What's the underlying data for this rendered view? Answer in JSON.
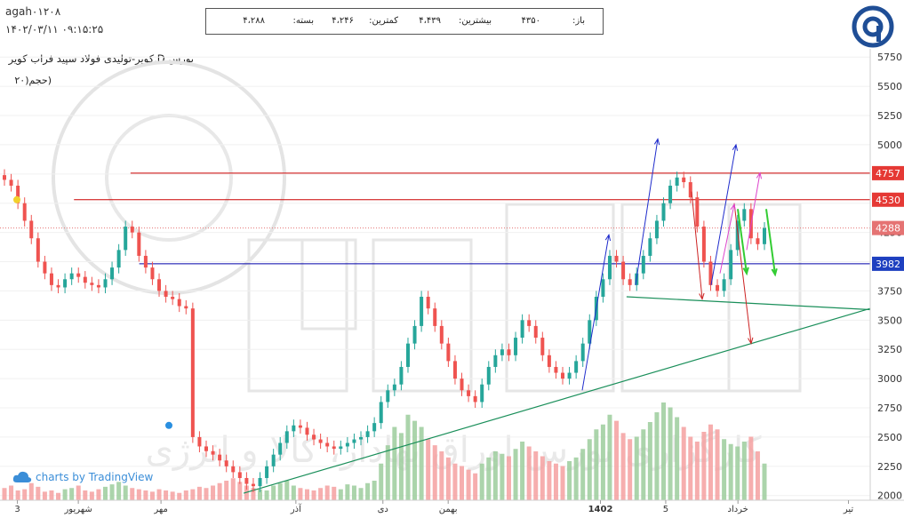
{
  "header": {
    "ticker_line": "agah۰۱۲۰۸",
    "datetime": "۱۴۰۲/۰۳/۱۱ ۰۹:۱۵:۲۵"
  },
  "ohlc": {
    "open_label": "باز:",
    "open_value": "۴۳۵۰",
    "high_label": "بیشترین:",
    "high_value": "۴،۴۳۹",
    "low_label": "کمترین:",
    "low_value": "۴،۲۴۶",
    "close_label": "بسته:",
    "close_value": "۴،۲۸۸"
  },
  "symbol_title": "بورس,D,کویر-تولیدی فولاد سپید فراب کویر",
  "volume_label": "(حجم(۲۰",
  "attribution": "charts by TradingView",
  "watermark_text": "کارگزاری بورس اوراق بهادار، کالا و انرژی",
  "colors": {
    "up": "#26a69a",
    "down": "#ef5350",
    "red_line": "#cc0000",
    "blue_line": "#0000aa",
    "green_line": "#1a8f5a"
  },
  "chart_data": {
    "type": "candlestick",
    "y_axis": {
      "ticks": [
        2000,
        2250,
        2500,
        2750,
        3000,
        3250,
        3500,
        3750,
        4000,
        4250,
        4500,
        4750,
        5000,
        5250,
        5500,
        5750
      ],
      "range": [
        1960,
        5820
      ]
    },
    "x_axis": {
      "labels": [
        "3",
        "شهریور",
        "مهر",
        "آذر",
        "دی",
        "بهمن",
        "1402",
        "5",
        "خرداد",
        "تیر"
      ],
      "positions": [
        0.02,
        0.09,
        0.185,
        0.34,
        0.44,
        0.515,
        0.69,
        0.765,
        0.848,
        0.975
      ]
    },
    "price_markers": [
      {
        "label": "4757",
        "value": 4757,
        "color": "#e53935"
      },
      {
        "label": "4530",
        "value": 4530,
        "color": "#e53935"
      },
      {
        "label": "4288",
        "value": 4288,
        "color": "#e57373"
      },
      {
        "label": "3982",
        "value": 3982,
        "color": "#1e40c0"
      }
    ],
    "horizontal_lines": [
      {
        "value": 4757,
        "color": "#cc0000",
        "start": 0.15
      },
      {
        "value": 4530,
        "color": "#cc0000",
        "start": 0.085
      },
      {
        "value": 3982,
        "color": "#0000aa",
        "start": 0.16
      }
    ],
    "trend_lines": [
      {
        "from": [
          0.28,
          2020
        ],
        "to": [
          1.0,
          3600
        ],
        "color": "#1a8f5a"
      },
      {
        "from": [
          0.72,
          3700
        ],
        "to": [
          1.0,
          3590
        ],
        "color": "#1a8f5a"
      }
    ],
    "closes": [
      4700,
      4650,
      4500,
      4350,
      4200,
      4000,
      3900,
      3800,
      3780,
      3850,
      3900,
      3870,
      3820,
      3800,
      3780,
      3850,
      3950,
      4100,
      4300,
      4250,
      4050,
      3950,
      3850,
      3750,
      3700,
      3680,
      3620,
      3600,
      2500,
      2420,
      2380,
      2350,
      2300,
      2250,
      2200,
      2150,
      2100,
      2080,
      2150,
      2250,
      2350,
      2450,
      2550,
      2600,
      2580,
      2520,
      2480,
      2450,
      2420,
      2400,
      2420,
      2450,
      2480,
      2500,
      2550,
      2620,
      2800,
      2900,
      2950,
      3100,
      3300,
      3450,
      3700,
      3600,
      3450,
      3300,
      3150,
      3000,
      2900,
      2850,
      2800,
      2950,
      3100,
      3200,
      3250,
      3200,
      3350,
      3500,
      3450,
      3350,
      3200,
      3100,
      3050,
      3000,
      3050,
      3150,
      3300,
      3500,
      3700,
      3850,
      4050,
      4000,
      3850,
      3800,
      3900,
      4050,
      4200,
      4350,
      4500,
      4650,
      4720,
      4680,
      4550,
      4300,
      4000,
      3800,
      3750,
      3850,
      4100,
      4350,
      4450,
      4200,
      4150,
      4288
    ],
    "volumes": [
      10,
      12,
      8,
      9,
      14,
      11,
      7,
      8,
      6,
      9,
      10,
      12,
      8,
      7,
      9,
      11,
      13,
      15,
      12,
      10,
      9,
      8,
      7,
      9,
      8,
      7,
      6,
      8,
      9,
      11,
      10,
      12,
      14,
      16,
      18,
      15,
      12,
      10,
      9,
      8,
      12,
      14,
      16,
      12,
      10,
      9,
      8,
      10,
      12,
      11,
      9,
      13,
      12,
      10,
      14,
      16,
      30,
      45,
      60,
      55,
      70,
      65,
      60,
      50,
      45,
      40,
      35,
      30,
      28,
      25,
      22,
      30,
      35,
      40,
      38,
      36,
      42,
      48,
      44,
      40,
      36,
      32,
      30,
      28,
      32,
      35,
      42,
      50,
      58,
      62,
      70,
      65,
      55,
      50,
      52,
      58,
      64,
      72,
      80,
      76,
      68,
      60,
      52,
      48,
      56,
      62,
      58,
      50,
      46,
      44,
      48,
      52,
      40,
      30
    ]
  }
}
